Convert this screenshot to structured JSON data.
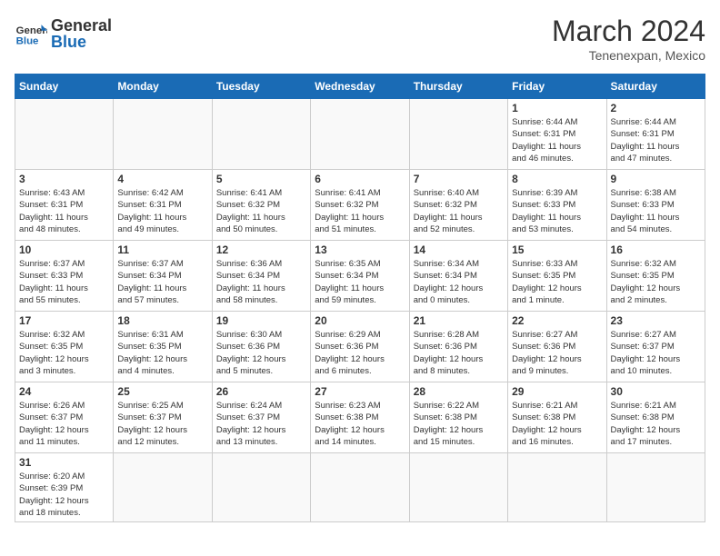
{
  "header": {
    "logo_general": "General",
    "logo_blue": "Blue",
    "month": "March 2024",
    "location": "Tenenexpan, Mexico"
  },
  "weekdays": [
    "Sunday",
    "Monday",
    "Tuesday",
    "Wednesday",
    "Thursday",
    "Friday",
    "Saturday"
  ],
  "weeks": [
    [
      {
        "day": "",
        "info": ""
      },
      {
        "day": "",
        "info": ""
      },
      {
        "day": "",
        "info": ""
      },
      {
        "day": "",
        "info": ""
      },
      {
        "day": "",
        "info": ""
      },
      {
        "day": "1",
        "info": "Sunrise: 6:44 AM\nSunset: 6:31 PM\nDaylight: 11 hours\nand 46 minutes."
      },
      {
        "day": "2",
        "info": "Sunrise: 6:44 AM\nSunset: 6:31 PM\nDaylight: 11 hours\nand 47 minutes."
      }
    ],
    [
      {
        "day": "3",
        "info": "Sunrise: 6:43 AM\nSunset: 6:31 PM\nDaylight: 11 hours\nand 48 minutes."
      },
      {
        "day": "4",
        "info": "Sunrise: 6:42 AM\nSunset: 6:31 PM\nDaylight: 11 hours\nand 49 minutes."
      },
      {
        "day": "5",
        "info": "Sunrise: 6:41 AM\nSunset: 6:32 PM\nDaylight: 11 hours\nand 50 minutes."
      },
      {
        "day": "6",
        "info": "Sunrise: 6:41 AM\nSunset: 6:32 PM\nDaylight: 11 hours\nand 51 minutes."
      },
      {
        "day": "7",
        "info": "Sunrise: 6:40 AM\nSunset: 6:32 PM\nDaylight: 11 hours\nand 52 minutes."
      },
      {
        "day": "8",
        "info": "Sunrise: 6:39 AM\nSunset: 6:33 PM\nDaylight: 11 hours\nand 53 minutes."
      },
      {
        "day": "9",
        "info": "Sunrise: 6:38 AM\nSunset: 6:33 PM\nDaylight: 11 hours\nand 54 minutes."
      }
    ],
    [
      {
        "day": "10",
        "info": "Sunrise: 6:37 AM\nSunset: 6:33 PM\nDaylight: 11 hours\nand 55 minutes."
      },
      {
        "day": "11",
        "info": "Sunrise: 6:37 AM\nSunset: 6:34 PM\nDaylight: 11 hours\nand 57 minutes."
      },
      {
        "day": "12",
        "info": "Sunrise: 6:36 AM\nSunset: 6:34 PM\nDaylight: 11 hours\nand 58 minutes."
      },
      {
        "day": "13",
        "info": "Sunrise: 6:35 AM\nSunset: 6:34 PM\nDaylight: 11 hours\nand 59 minutes."
      },
      {
        "day": "14",
        "info": "Sunrise: 6:34 AM\nSunset: 6:34 PM\nDaylight: 12 hours\nand 0 minutes."
      },
      {
        "day": "15",
        "info": "Sunrise: 6:33 AM\nSunset: 6:35 PM\nDaylight: 12 hours\nand 1 minute."
      },
      {
        "day": "16",
        "info": "Sunrise: 6:32 AM\nSunset: 6:35 PM\nDaylight: 12 hours\nand 2 minutes."
      }
    ],
    [
      {
        "day": "17",
        "info": "Sunrise: 6:32 AM\nSunset: 6:35 PM\nDaylight: 12 hours\nand 3 minutes."
      },
      {
        "day": "18",
        "info": "Sunrise: 6:31 AM\nSunset: 6:35 PM\nDaylight: 12 hours\nand 4 minutes."
      },
      {
        "day": "19",
        "info": "Sunrise: 6:30 AM\nSunset: 6:36 PM\nDaylight: 12 hours\nand 5 minutes."
      },
      {
        "day": "20",
        "info": "Sunrise: 6:29 AM\nSunset: 6:36 PM\nDaylight: 12 hours\nand 6 minutes."
      },
      {
        "day": "21",
        "info": "Sunrise: 6:28 AM\nSunset: 6:36 PM\nDaylight: 12 hours\nand 8 minutes."
      },
      {
        "day": "22",
        "info": "Sunrise: 6:27 AM\nSunset: 6:36 PM\nDaylight: 12 hours\nand 9 minutes."
      },
      {
        "day": "23",
        "info": "Sunrise: 6:27 AM\nSunset: 6:37 PM\nDaylight: 12 hours\nand 10 minutes."
      }
    ],
    [
      {
        "day": "24",
        "info": "Sunrise: 6:26 AM\nSunset: 6:37 PM\nDaylight: 12 hours\nand 11 minutes."
      },
      {
        "day": "25",
        "info": "Sunrise: 6:25 AM\nSunset: 6:37 PM\nDaylight: 12 hours\nand 12 minutes."
      },
      {
        "day": "26",
        "info": "Sunrise: 6:24 AM\nSunset: 6:37 PM\nDaylight: 12 hours\nand 13 minutes."
      },
      {
        "day": "27",
        "info": "Sunrise: 6:23 AM\nSunset: 6:38 PM\nDaylight: 12 hours\nand 14 minutes."
      },
      {
        "day": "28",
        "info": "Sunrise: 6:22 AM\nSunset: 6:38 PM\nDaylight: 12 hours\nand 15 minutes."
      },
      {
        "day": "29",
        "info": "Sunrise: 6:21 AM\nSunset: 6:38 PM\nDaylight: 12 hours\nand 16 minutes."
      },
      {
        "day": "30",
        "info": "Sunrise: 6:21 AM\nSunset: 6:38 PM\nDaylight: 12 hours\nand 17 minutes."
      }
    ],
    [
      {
        "day": "31",
        "info": "Sunrise: 6:20 AM\nSunset: 6:39 PM\nDaylight: 12 hours\nand 18 minutes."
      },
      {
        "day": "",
        "info": ""
      },
      {
        "day": "",
        "info": ""
      },
      {
        "day": "",
        "info": ""
      },
      {
        "day": "",
        "info": ""
      },
      {
        "day": "",
        "info": ""
      },
      {
        "day": "",
        "info": ""
      }
    ]
  ]
}
